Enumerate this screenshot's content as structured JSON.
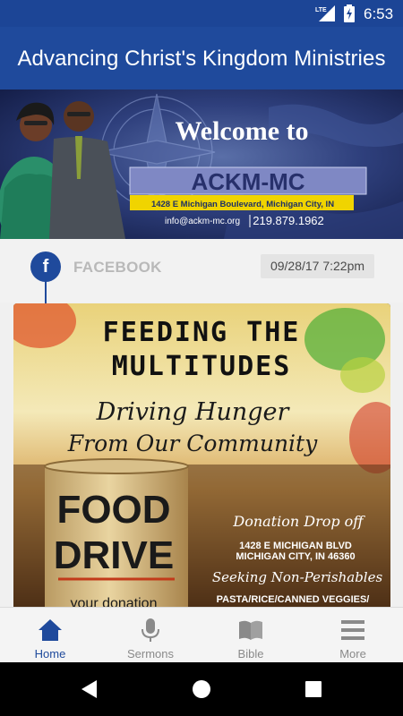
{
  "status_bar": {
    "network": "LTE",
    "time": "6:53"
  },
  "app_bar": {
    "title": "Advancing Christ's Kingdom Ministries"
  },
  "banner": {
    "welcome": "Welcome to",
    "org": "ACKM-MC",
    "address": "1428 E Michigan Boulevard, Michigan City, IN",
    "email": "info@ackm-mc.org",
    "phone": "219.879.1962"
  },
  "feed": {
    "source_icon": "facebook-icon",
    "source_label": "FACEBOOK",
    "date": "09/28/17 7:22pm",
    "post": {
      "title_line1": "FEEDING THE",
      "title_line2": "MULTITUDES",
      "script_line1": "Driving Hunger",
      "script_line2": "From Our Community",
      "can_line1": "FOOD",
      "can_line2": "DRIVE",
      "can_line3": "your donation",
      "dropoff_label": "Donation Drop off",
      "dropoff_address1": "1428 E MICHIGAN BLVD",
      "dropoff_address2": "MICHIGAN CITY, IN 46360",
      "seeking": "Seeking Non-Perishables",
      "items": "PASTA/RICE/CANNED VEGGIES/"
    }
  },
  "bottom_nav": {
    "items": [
      {
        "label": "Home",
        "icon": "home-icon",
        "active": true
      },
      {
        "label": "Sermons",
        "icon": "microphone-icon",
        "active": false
      },
      {
        "label": "Bible",
        "icon": "book-icon",
        "active": false
      },
      {
        "label": "More",
        "icon": "menu-icon",
        "active": false
      }
    ]
  },
  "colors": {
    "primary": "#1f4a9c",
    "status_bar": "#1c4596",
    "inactive": "#8a8a8a"
  }
}
